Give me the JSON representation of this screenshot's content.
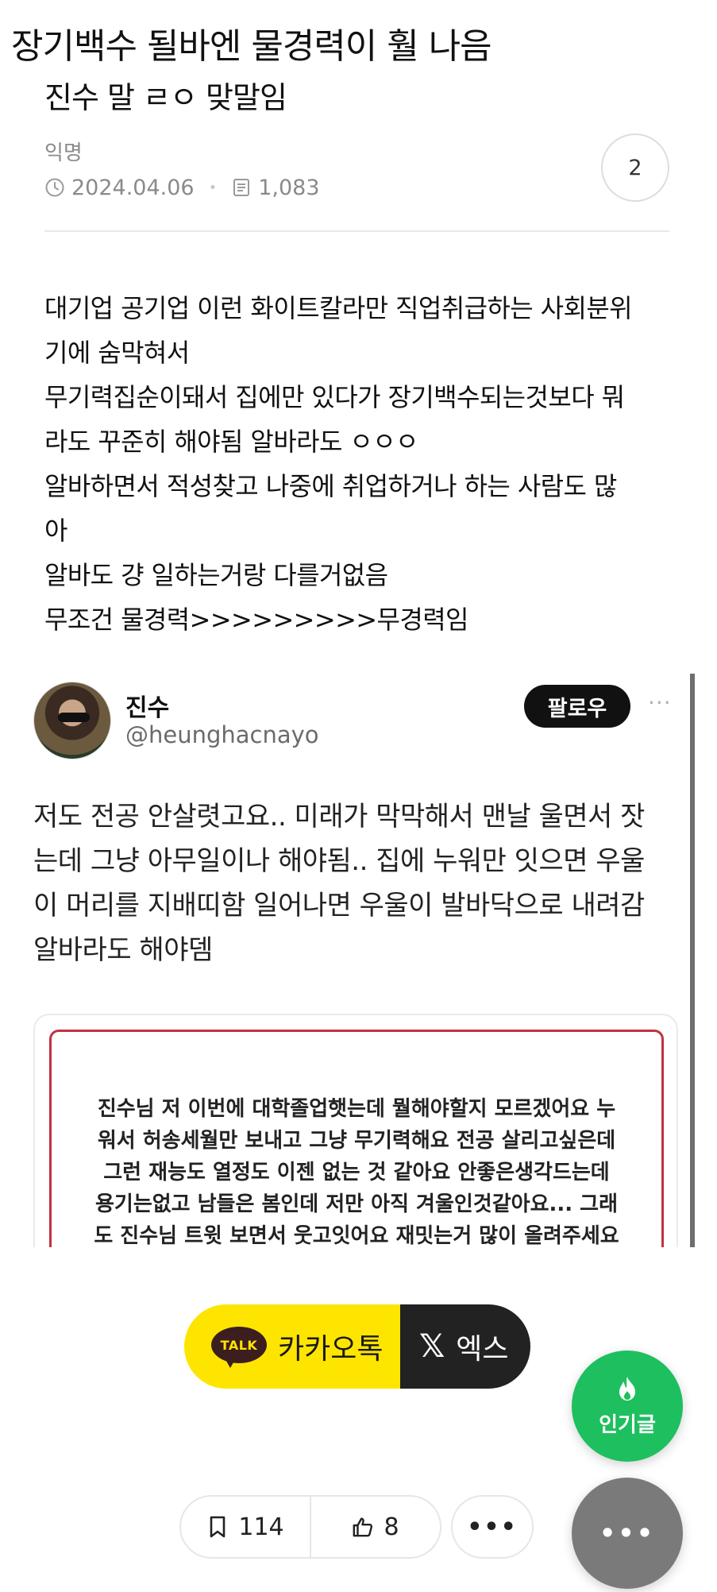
{
  "post": {
    "title": "장기백수 될바엔 물경력이 훨 나음",
    "subtitle": "진수 말 ㄹㅇ 맞말임",
    "author": "익명",
    "date": "2024.04.06",
    "views": "1,083",
    "comment_count": "2",
    "body_lines": [
      "대기업 공기업 이런 화이트칼라만 직업취급하는 사회분위",
      "기에 숨막혀서",
      "무기력집순이돼서 집에만 있다가 장기백수되는것보다 뭐",
      "라도 꾸준히 해야됨 알바라도 ㅇㅇㅇ",
      "알바하면서 적성찾고 나중에 취업하거나 하는 사람도 많",
      "아",
      "알바도 걍 일하는거랑 다를거없음",
      "무조건 물경력>>>>>>>>>무경력임"
    ]
  },
  "tweet": {
    "name": "진수",
    "handle": "@heunghacnayo",
    "follow_label": "팔로우",
    "more_label": "···",
    "text_lines": [
      "저도 전공 안살렷고요.. 미래가 막막해서 맨날 울면서 잣",
      "는데 그냥 아무일이나 해야됨.. 집에 누워만 잇으면 우울",
      "이 머리를 지배띠함 일어나면 우울이 발바닥으로 내려감",
      "알바라도 해야뎀"
    ],
    "card_lines": [
      "진수님 저 이번에 대학졸업햇는데 뭘해야할지 모르겠어요 누",
      "워서 허송세월만 보내고 그냥 무기력해요 전공 살리고싶은데",
      "그런 재능도 열정도 이젠 없는 것 같아요 안좋은생각드는데",
      "용기는없고 남들은 봄인데 저만 아직 겨울인것같아요... 그래",
      "도 진수님 트윗 보면서 웃고잇어요 재밋는거 많이 올려주세요"
    ]
  },
  "share": {
    "kakao_badge": "TALK",
    "kakao_label": "카카오톡",
    "x_glyph": "𝕏",
    "x_label": "엑스"
  },
  "fab": {
    "popular_label": "인기글",
    "more_label": "•••"
  },
  "actions": {
    "bookmark_count": "114",
    "like_count": "8",
    "more_label": "•••"
  },
  "colors": {
    "kakao_yellow": "#fee500",
    "x_black": "#222222",
    "popular_green": "#1dbf5e",
    "fab_gray": "#7a7a7a",
    "card_border_red": "#c2323f"
  },
  "icons": {
    "clock": "clock-icon",
    "views": "document-icon",
    "bookmark": "bookmark-icon",
    "like": "thumbs-up-icon",
    "fire": "fire-icon"
  }
}
